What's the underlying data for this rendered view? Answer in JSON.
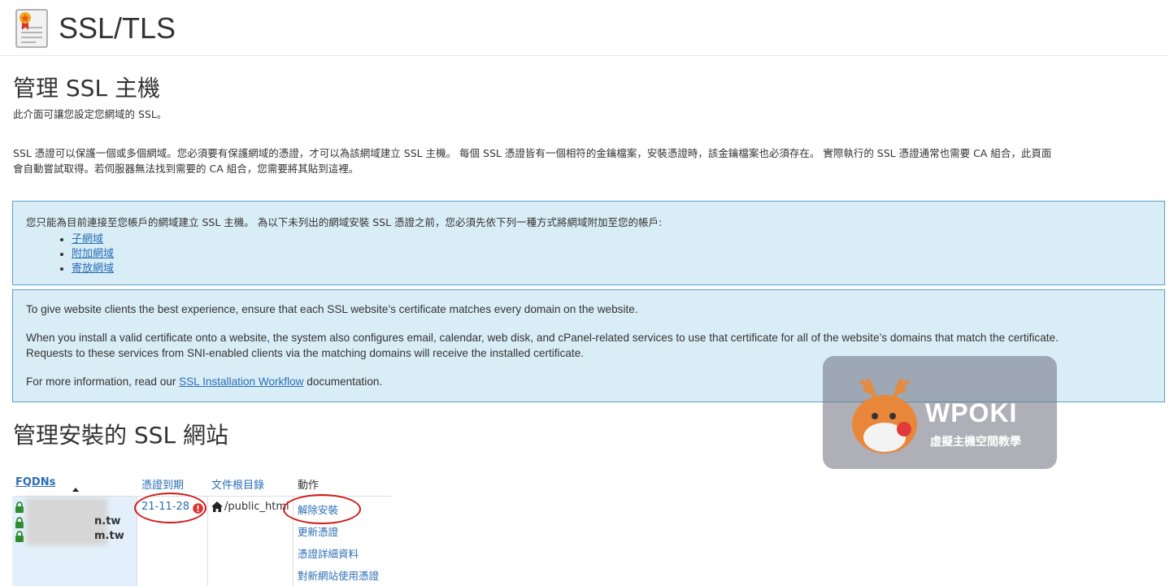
{
  "header": {
    "title": "SSL/TLS",
    "icon": "certificate-icon"
  },
  "manage_hosts": {
    "heading": "管理 SSL 主機",
    "intro": "此介面可讓您設定您網域的 SSL。",
    "paragraph_line1": "SSL 憑證可以保護一個或多個網域。您必須要有保護網域的憑證，才可以為該網域建立 SSL 主機。 每個 SSL 憑證皆有一個相符的金鑰檔案，安裝憑證時，該金鑰檔案也必須存在。 實際執行的 SSL 憑證通常也需要 CA 組合，此頁面",
    "paragraph_line2": "會自動嘗試取得。若伺服器無法找到需要的 CA 組合，您需要將其貼到這裡。"
  },
  "notice_box": {
    "text": "您只能為目前連接至您帳戶的網域建立 SSL 主機。 為以下未列出的網域安裝 SSL 憑證之前，您必須先依下列一種方式將網域附加至您的帳戶:",
    "links": [
      "子網域",
      "附加網域",
      "寄放網域"
    ]
  },
  "info_box": {
    "p1": "To give website clients the best experience, ensure that each SSL website’s certificate matches every domain on the website.",
    "p2_line1": "When you install a valid certificate onto a website, the system also configures email, calendar, web disk, and cPanel-related services to use that certificate for all of the website’s domains that match the certificate.",
    "p2_line2": "Requests to these services from SNI-enabled clients via the matching domains will receive the installed certificate.",
    "p3_prefix": "For more information, read our ",
    "p3_link": "SSL Installation Workflow",
    "p3_suffix": " documentation."
  },
  "installed_sites": {
    "heading": "管理安裝的 SSL 網站",
    "columns": {
      "fqdns": "FQDNs",
      "expiry": "憑證到期",
      "docroot": "文件根目錄",
      "actions": "動作"
    },
    "row": {
      "domains": [
        "n.tw",
        "m.tw"
      ],
      "expiry": "21-11-28",
      "docroot": "/public_html",
      "actions": [
        "解除安裝",
        "更新憑證",
        "憑證詳細資料",
        "對新網站使用憑證"
      ]
    }
  },
  "watermark": {
    "title": "WPOKI",
    "subtitle": "虛擬主機空間教學"
  },
  "colors": {
    "link": "#2a6eb5",
    "info_bg": "#d9edf7",
    "info_border": "#5ea1c9",
    "lock": "#2e8b2e",
    "highlight": "#d11a1a"
  }
}
